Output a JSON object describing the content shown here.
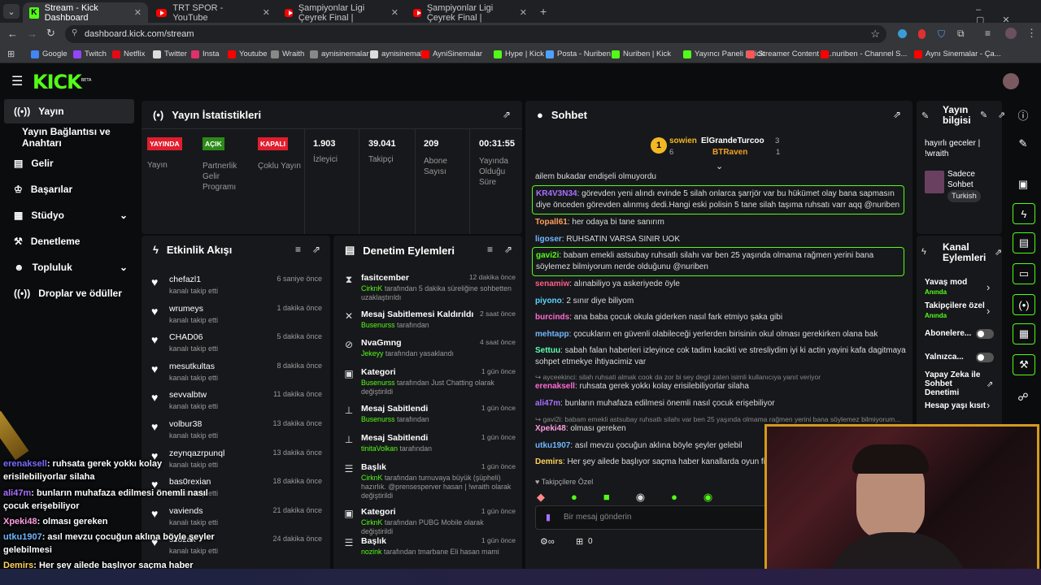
{
  "browser": {
    "tabs": [
      {
        "title": "Stream - Kick Dashboard",
        "active": true
      },
      {
        "title": "TRT SPOR - YouTube"
      },
      {
        "title": "Şampiyonlar Ligi Çeyrek Final |"
      },
      {
        "title": "Şampiyonlar Ligi Çeyrek Final |"
      }
    ],
    "url": "dashboard.kick.com/stream",
    "bookmarks": [
      "Google",
      "Twitch",
      "Netflix",
      "Twitter",
      "Insta",
      "Youtube",
      "Wraith",
      "aynisinemalar",
      "aynisinemalar",
      "AyniSinemalar",
      "Hype | Kick",
      "Posta - Nuriben",
      "Nuriben | Kick",
      "Yayıncı Paneli | Kick",
      "Streamer Content M...",
      "nuriben - Channel S...",
      "Aynı Sinemalar - Ça..."
    ]
  },
  "brand": {
    "logo": "KICK",
    "beta": "BETA",
    "accent": "#53fc18"
  },
  "sidebar": {
    "items": [
      {
        "label": "Yayın"
      },
      {
        "label": "Yayın Bağlantısı ve Anahtarı"
      },
      {
        "label": "Gelir"
      },
      {
        "label": "Başarılar"
      },
      {
        "label": "Stüdyo"
      },
      {
        "label": "Denetleme"
      },
      {
        "label": "Topluluk"
      },
      {
        "label": "Droplar ve ödüller"
      }
    ]
  },
  "stats": {
    "title": "Yayın İstatistikleri",
    "live_tag": "YAYINDA",
    "live_label": "Yayın",
    "partner_tag": "AÇIK",
    "partner_label": "Partnerlik Gelir Programı",
    "multi_tag": "KAPALI",
    "multi_label": "Çoklu Yayın",
    "viewers": "1.903",
    "viewers_label": "İzleyici",
    "followers": "39.041",
    "followers_label": "Takipçi",
    "subs": "209",
    "subs_label": "Abone Sayısı",
    "uptime": "00:31:55",
    "uptime_label": "Yayında Olduğu Süre"
  },
  "activity": {
    "title": "Etkinlik Akışı",
    "items": [
      {
        "name": "chefazl1",
        "sub": "kanalı takip etti",
        "time": "6 saniye önce"
      },
      {
        "name": "wrumeys",
        "sub": "kanalı takip etti",
        "time": "1 dakika önce"
      },
      {
        "name": "CHAD06",
        "sub": "kanalı takip etti",
        "time": "5 dakika önce"
      },
      {
        "name": "mesutkultas",
        "sub": "kanalı takip etti",
        "time": "8 dakika önce"
      },
      {
        "name": "sevvalbtw",
        "sub": "kanalı takip etti",
        "time": "11 dakika önce"
      },
      {
        "name": "volbur38",
        "sub": "kanalı takip etti",
        "time": "13 dakika önce"
      },
      {
        "name": "zeynqazrpunql",
        "sub": "kanalı takip etti",
        "time": "13 dakika önce"
      },
      {
        "name": "bas0rexian",
        "sub": "kanalı takip etti",
        "time": "18 dakika önce"
      },
      {
        "name": "vaviends",
        "sub": "kanalı takip etti",
        "time": "21 dakika önce"
      },
      {
        "name": "szozak",
        "sub": "kanalı takip etti",
        "time": "24 dakika önce"
      }
    ]
  },
  "modlog": {
    "title": "Denetim Eylemleri",
    "items": [
      {
        "name": "fasitcember",
        "who": "CirknK",
        "sub": " tarafından 5 dakika süreliğine sohbetten uzaklaştırıldı",
        "time": "12 dakika önce",
        "icon": "⧗"
      },
      {
        "name": "Mesaj Sabitlemesi Kaldırıldı",
        "who": "Busenurss",
        "sub": " tarafından",
        "time": "2 saat önce",
        "icon": "✕"
      },
      {
        "name": "NvaGmng",
        "who": "Jekeyy",
        "sub": " tarafından yasaklandı",
        "time": "4 saat önce",
        "icon": "⊘"
      },
      {
        "name": "Kategori",
        "who": "Busenurss",
        "sub": " tarafından Just Chatting olarak değiştirildi",
        "time": "1 gün önce",
        "icon": "▣"
      },
      {
        "name": "Mesaj Sabitlendi",
        "who": "Busenurss",
        "sub": " tarafından",
        "time": "1 gün önce",
        "icon": "⊥"
      },
      {
        "name": "Mesaj Sabitlendi",
        "who": "tinitaVolkan",
        "sub": " tarafından",
        "time": "1 gün önce",
        "icon": "⊥"
      },
      {
        "name": "Başlık",
        "who": "CirknK",
        "sub": " tarafından turnuvaya büyük (şüpheli) hazırlık. @prensesperver hasan | !wraith olarak değiştirildi",
        "time": "1 gün önce",
        "icon": "☰"
      },
      {
        "name": "Kategori",
        "who": "CirknK",
        "sub": " tarafından PUBG Mobile olarak değiştirildi",
        "time": "1 gün önce",
        "icon": "▣"
      },
      {
        "name": "Başlık",
        "who": "nozink",
        "sub": " tarafından tmarbane Eli hasan mami",
        "time": "1 gün önce",
        "icon": "☰"
      }
    ]
  },
  "chat": {
    "title": "Sohbet",
    "top": [
      {
        "rank": "1",
        "name": "sowien",
        "count": "6"
      },
      {
        "name": "ElGrandeTurcoo",
        "count": "3"
      },
      {
        "name": "BTRaven",
        "count": "1"
      }
    ],
    "messages": [
      {
        "user": "",
        "text": "ailem bukadar endişeli olmuyordu",
        "color": "#ddd"
      },
      {
        "user": "KR4V3N34",
        "text": ": görevden yeni alındı evinde 5 silah onlarca şarrjör var bu hükümet olay bana sapmasın diye önceden görevden alınmış dedi.Hangi eski polisin 5 tane silah taşıma ruhsatı varr aqq @nuriben",
        "color": "#a970ff",
        "hl": true
      },
      {
        "user": "Topall61",
        "text": ": her odaya bi tane sanırım",
        "color": "#ff9d5c"
      },
      {
        "user": "ligoser",
        "text": ": RUHSATIN VARSA SINIR UOK",
        "color": "#6fb7ff"
      },
      {
        "user": "gavi2i",
        "text": ": babam emekli astsubay ruhsatlı silahı var ben 25 yaşında olmama rağmen yerini bana söylemez bilmiyorum nerde olduğunu @nuriben",
        "color": "#53fc18",
        "hl": true
      },
      {
        "user": "senamiw",
        "text": ": alınabiliyo ya askeriyede öyle",
        "color": "#ff5c8a"
      },
      {
        "user": "piyono",
        "text": ": 2 sınır diye biliyom",
        "color": "#5cd6ff"
      },
      {
        "user": "burcinds",
        "text": ": ana baba çocuk okula giderken nasıl fark etmiyo şaka gibi",
        "color": "#ff6bd6"
      },
      {
        "user": "mehtapp",
        "text": ": çocukların en güvenli olabileceği yerlerden birisinin okul olması gerekirken olana bak",
        "color": "#6fb7ff"
      },
      {
        "user": "Settuu",
        "text": ": sabah falan haberleri izleyince cok tadim kacikti ve stresliydim iyi ki actin yayini kafa dagitmaya sohpet etmekye ihtiyacimiz var",
        "color": "#5cffb0"
      },
      {
        "user": "erenaksell",
        "text": ": ruhsata gerek yokkı kolay erisilebiliyorlar silaha",
        "color": "#ff6bd6"
      },
      {
        "user": "ali47m",
        "text": ": bunların muhafaza edilmesi önemli nasıl çocuk erişebiliyor",
        "color": "#a970ff"
      },
      {
        "user": "Xpeki48",
        "text": ": olması gereken",
        "color": "#ff9de2"
      },
      {
        "user": "utku1907",
        "text": ": asıl mevzu çocuğun aklına böyle şeyler gelebil",
        "color": "#6fb7ff"
      },
      {
        "user": "Demirs",
        "text": ": Her şey ailede başlıyor saçma haber kanallarda oyun film b",
        "color": "#ffd25c"
      }
    ],
    "reply1": "↪ ayceekinci: silah ruhsati almak cook da zor bi sey degil zaten isimli kullanıcıya yanıt veriyor",
    "reply2": "↪ gavi2i: babam emekli astsubay ruhsatlı silahı var ben 25 yaşında olmama rağmen yerini bana söylemez bilmiyorum...",
    "followers_only": "Takipçilere Özel",
    "placeholder": "Bir mesaj gönderin",
    "count": "0"
  },
  "info": {
    "title": "Yayın bilgisi",
    "stream_title": "hayırlı geceler | !wraith",
    "category": "Sadece Sohbet",
    "language": "Turkish"
  },
  "actions": {
    "title": "Kanal Eylemleri",
    "items": [
      {
        "label": "Yavaş mod",
        "sub": "Anında"
      },
      {
        "label": "Takipçilere özel",
        "sub": "Anında"
      },
      {
        "label": "Abonelere..."
      },
      {
        "label": "Yalnızca..."
      },
      {
        "label": "Yapay Zeka ile Sohbet Denetimi"
      },
      {
        "label": "Hesap yaşı kısıt"
      }
    ]
  },
  "overlay": {
    "lines": [
      {
        "user": "erenaksell",
        "text": ": ruhsata gerek yokkı kolay erisilebiliyorlar silaha"
      },
      {
        "user": "ali47m",
        "text": ": bunların muhafaza edilmesi önemli nasıl çocuk erişebiliyor"
      },
      {
        "user": "Xpeki48",
        "text": ": olması gereken"
      },
      {
        "user": "utku1907",
        "text": ": asıl mevzu çocuğun aklına böyle şeyler gelebilmesi"
      },
      {
        "user": "Demirs",
        "text": ": Her şey ailede başlıyor saçma haber kanallarda oyun film başhediyor"
      }
    ]
  }
}
